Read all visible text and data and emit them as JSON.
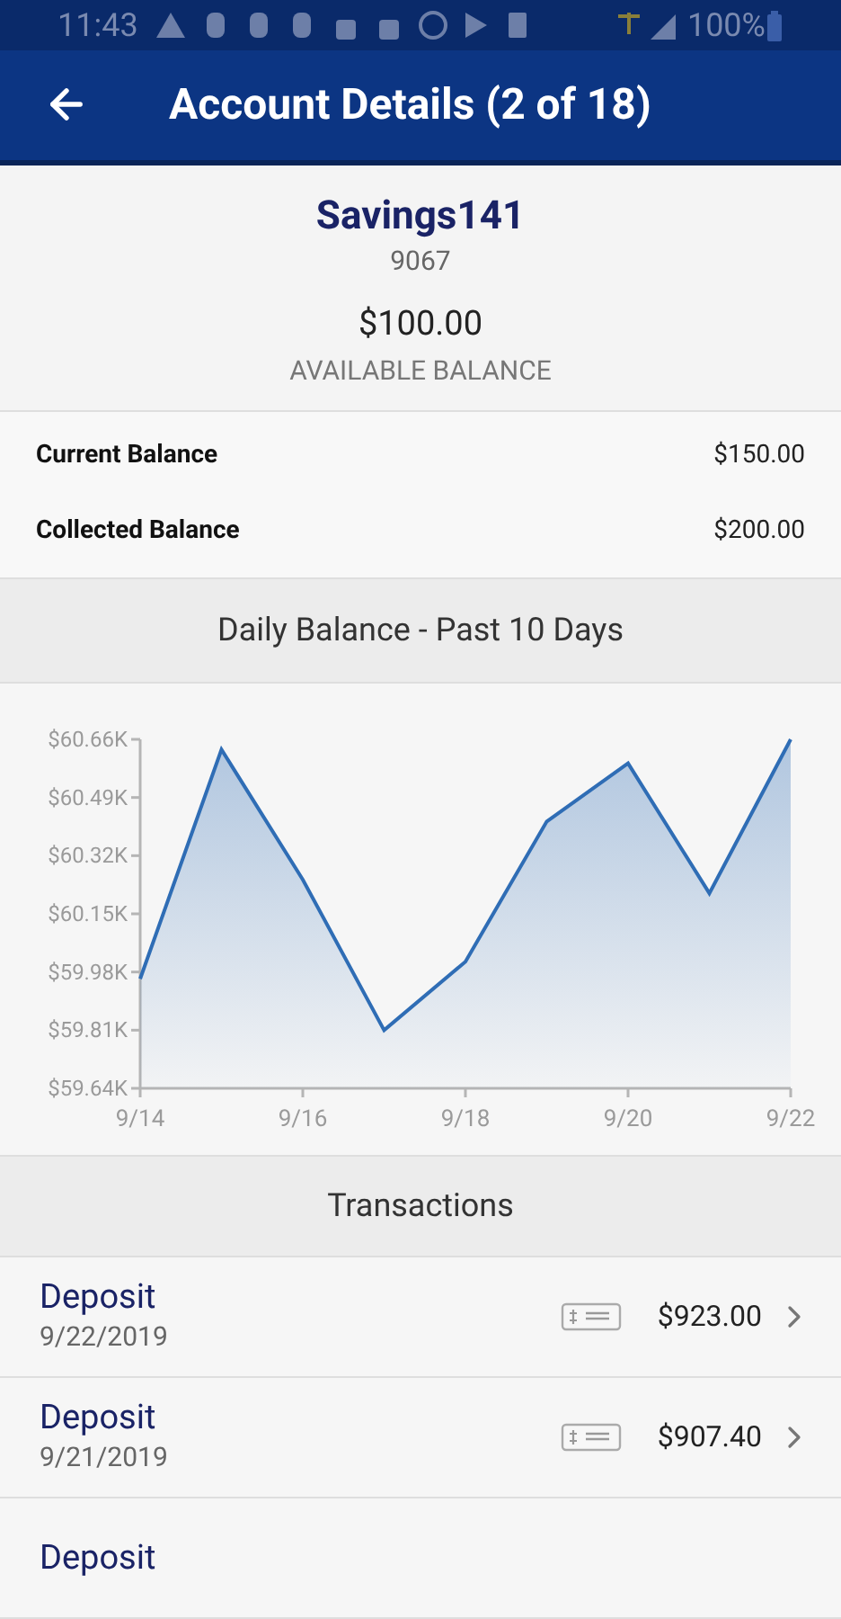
{
  "status_bar": {
    "time": "11:43",
    "battery": "100%"
  },
  "header": {
    "title": "Account Details (2 of 18)"
  },
  "account": {
    "name": "Savings141",
    "number": "9067",
    "available_amount": "$100.00",
    "available_label": "AVAILABLE BALANCE"
  },
  "balances": [
    {
      "label": "Current Balance",
      "value": "$150.00"
    },
    {
      "label": "Collected Balance",
      "value": "$200.00"
    }
  ],
  "chart_section": {
    "title": "Daily Balance - Past 10 Days",
    "chart_data": {
      "type": "area",
      "categories": [
        "9/14",
        null,
        "9/16",
        null,
        "9/18",
        null,
        "9/20",
        null,
        "9/22"
      ],
      "series": [
        {
          "color": "#2f6db5",
          "values": [
            59.96,
            60.63,
            60.25,
            59.81,
            60.01,
            60.42,
            60.59,
            60.21,
            60.66
          ]
        }
      ],
      "ylim": [
        59.64,
        60.66
      ],
      "yticks": [
        {
          "value": 59.64,
          "label": "$59.64K"
        },
        {
          "value": 59.81,
          "label": "$59.81K"
        },
        {
          "value": 59.98,
          "label": "$59.98K"
        },
        {
          "value": 60.15,
          "label": "$60.15K"
        },
        {
          "value": 60.32,
          "label": "$60.32K"
        },
        {
          "value": 60.49,
          "label": "$60.49K"
        },
        {
          "value": 60.66,
          "label": "$60.66K"
        }
      ]
    }
  },
  "transactions": {
    "title": "Transactions",
    "rows": [
      {
        "description": "Deposit",
        "date": "9/22/2019",
        "amount": "$923.00"
      },
      {
        "description": "Deposit",
        "date": "9/21/2019",
        "amount": "$907.40"
      },
      {
        "description": "Deposit"
      }
    ]
  }
}
